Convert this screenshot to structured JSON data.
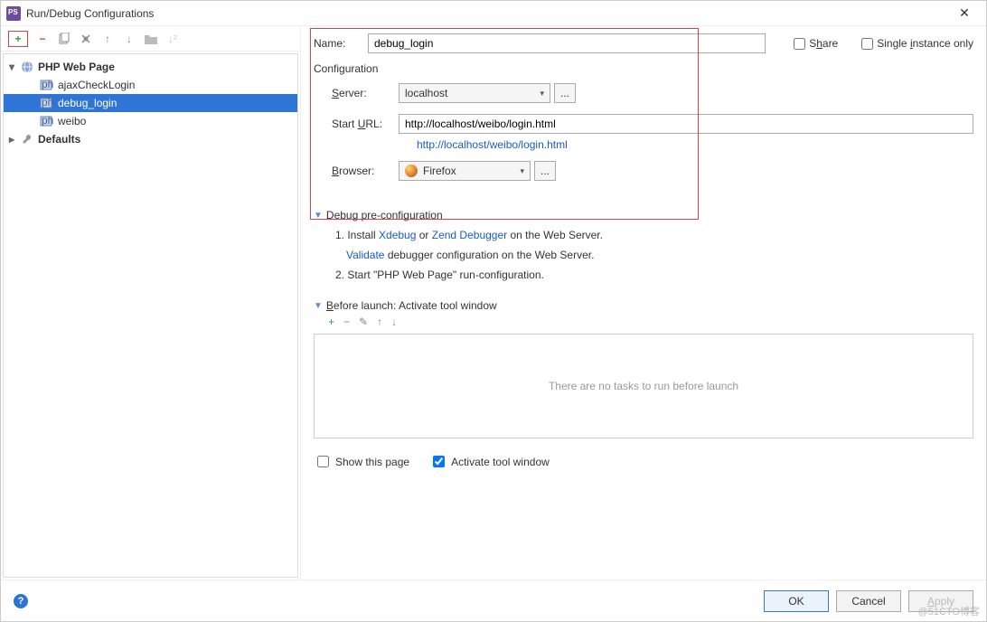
{
  "window": {
    "title": "Run/Debug Configurations"
  },
  "toolbar": {
    "add": "+",
    "remove": "−"
  },
  "tree": {
    "groups": [
      {
        "label": "PHP Web Page",
        "expanded": true
      },
      {
        "label": "Defaults",
        "expanded": false
      }
    ],
    "items": [
      "ajaxCheckLogin",
      "debug_login",
      "weibo"
    ],
    "selected": "debug_login"
  },
  "form": {
    "name_label": "Name:",
    "name_value": "debug_login",
    "share_label": "Share",
    "single_label": "Single instance only",
    "config_heading": "Configuration",
    "server_label": "Server:",
    "server_value": "localhost",
    "url_label": "Start URL:",
    "url_value": "http://localhost/weibo/login.html",
    "url_echo": "http://localhost/weibo/login.html",
    "browser_label": "Browser:",
    "browser_value": "Firefox",
    "dots": "..."
  },
  "debug_section": {
    "title": "Debug pre-configuration",
    "step1_prefix": "1. Install ",
    "xdebug": "Xdebug",
    "or": " or ",
    "zend": "Zend Debugger",
    "step1_suffix": " on the Web Server.",
    "validate": "Validate",
    "validate_suffix": " debugger configuration on the Web Server.",
    "step2": "2. Start \"PHP Web Page\" run-configuration."
  },
  "before_section": {
    "title": "Before launch: Activate tool window",
    "empty": "There are no tasks to run before launch",
    "show_page": "Show this page",
    "activate": "Activate tool window",
    "activate_checked": true
  },
  "footer": {
    "ok": "OK",
    "cancel": "Cancel",
    "apply": "Apply"
  },
  "watermark": "@51CTO博客"
}
